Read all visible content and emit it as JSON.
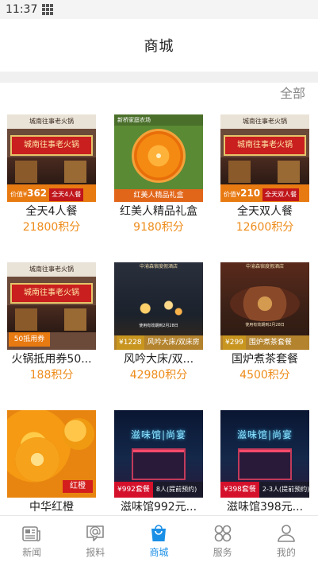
{
  "status_bar": {
    "time": "11:37"
  },
  "header": {
    "title": "商城"
  },
  "all_link": "全部",
  "products": [
    {
      "name": "全天4人餐",
      "points": "21800积分",
      "thumb": {
        "kind": "hotpot",
        "top": "城南往事老火锅",
        "sign": "城南往事老火锅",
        "price_prefix": "价值¥",
        "price": "362",
        "tag": "全天4人餐"
      }
    },
    {
      "name": "红美人精品礼盒",
      "points": "9180积分",
      "thumb": {
        "kind": "orange-gift",
        "top": "新桥家庭农场",
        "banner": "红美人精品礼盒"
      }
    },
    {
      "name": "全天双人餐",
      "points": "12600积分",
      "thumb": {
        "kind": "hotpot",
        "top": "城南往事老火锅",
        "sign": "城南往事老火锅",
        "price_prefix": "价值¥",
        "price": "210",
        "tag": "全天双人餐"
      }
    },
    {
      "name": "火锅抵用券50...",
      "points": "188积分",
      "thumb": {
        "kind": "hotpot-voucher",
        "top": "城南往事老火锅",
        "sign": "城南往事老火锅",
        "badge": "50抵用券"
      }
    },
    {
      "name": "风吟大床/双...",
      "points": "42980积分",
      "thumb": {
        "kind": "resort",
        "top": "中渝森宿度假酒店",
        "caption": "使用有效期到2月28日",
        "price": "¥1228",
        "room": "风吟大床/双床房"
      }
    },
    {
      "name": "国炉煮茶套餐",
      "points": "4500积分",
      "thumb": {
        "kind": "tea",
        "top": "中渝森宿度假酒店",
        "caption": "使用有效期到2月28日",
        "price": "¥299",
        "room": "围炉煮茶套餐"
      }
    },
    {
      "name": "中华红橙",
      "points": "",
      "thumb": {
        "kind": "big-orange",
        "tag": "红橙"
      }
    },
    {
      "name": "滋味馆992元...",
      "points": "",
      "thumb": {
        "kind": "restaurant",
        "sign": "滋味馆|尚宴",
        "price": "¥992套餐",
        "note": "8人(提前预约)"
      }
    },
    {
      "name": "滋味馆398元...",
      "points": "",
      "thumb": {
        "kind": "restaurant",
        "sign": "滋味馆|尚宴",
        "price": "¥398套餐",
        "note": "2-3人(提前预约)"
      }
    }
  ],
  "tabbar": [
    {
      "label": "新闻",
      "icon": "news-icon",
      "active": false
    },
    {
      "label": "报料",
      "icon": "report-icon",
      "active": false
    },
    {
      "label": "商城",
      "icon": "shopping-bag-icon",
      "active": true
    },
    {
      "label": "服务",
      "icon": "services-icon",
      "active": false
    },
    {
      "label": "我的",
      "icon": "profile-icon",
      "active": false
    }
  ],
  "colors": {
    "accent": "#1a8fe6",
    "points": "#ee8c1b",
    "label_inactive": "#888888"
  }
}
